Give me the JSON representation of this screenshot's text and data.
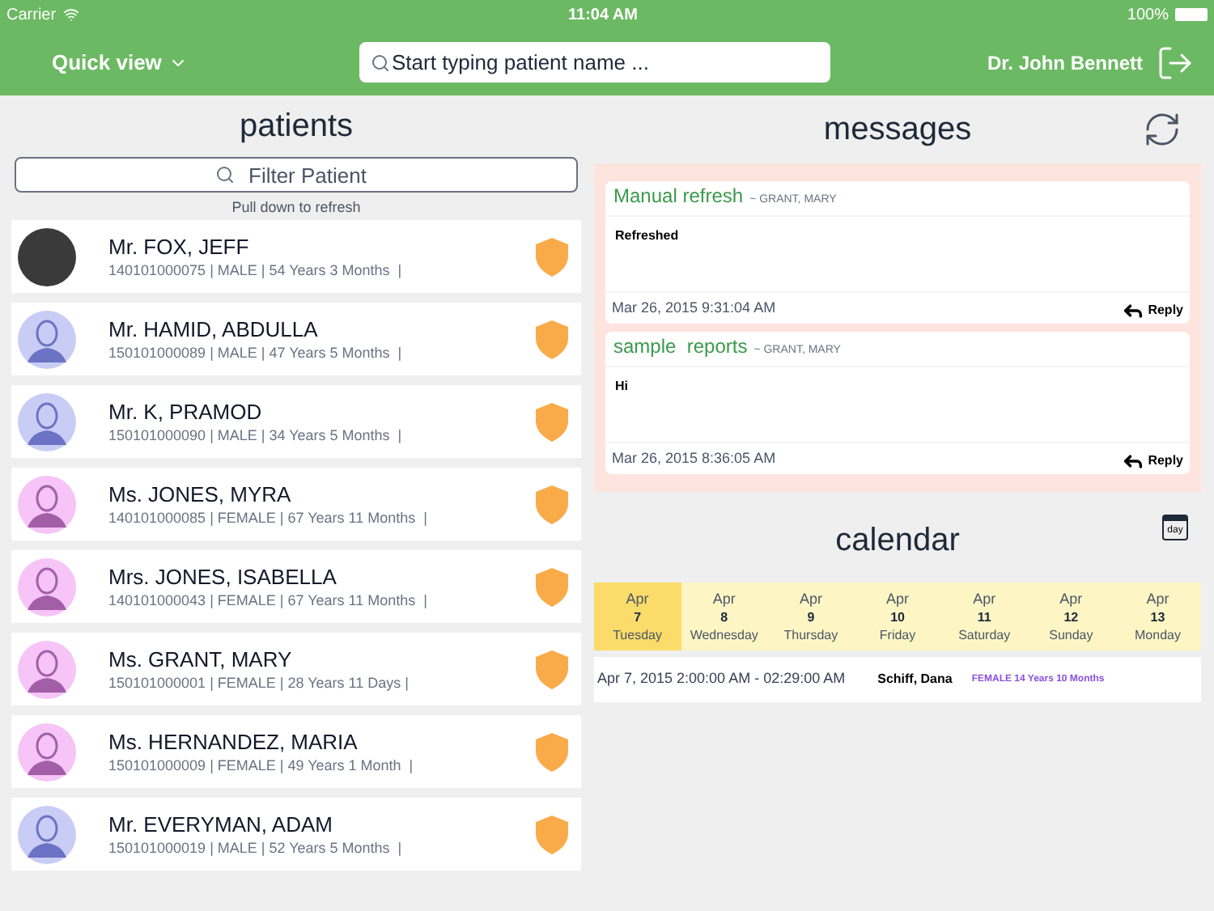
{
  "status_bar": {
    "carrier": "Carrier",
    "time": "11:04 AM",
    "battery": "100%"
  },
  "nav": {
    "quick_view": "Quick view",
    "search_placeholder": "Start typing patient name ...",
    "user": "Dr. John Bennett"
  },
  "patients": {
    "title": "patients",
    "filter_placeholder": "Filter Patient",
    "hint": "Pull down to refresh",
    "items": [
      {
        "name": "Mr. FOX, JEFF",
        "meta": "140101000075 | MALE | 54 Years 3 Months  |",
        "kind": "photo"
      },
      {
        "name": "Mr. HAMID, ABDULLA",
        "meta": "150101000089 | MALE | 47 Years 5 Months  |",
        "kind": "male"
      },
      {
        "name": "Mr. K, PRAMOD",
        "meta": "150101000090 | MALE | 34 Years 5 Months  |",
        "kind": "male"
      },
      {
        "name": "Ms. JONES, MYRA",
        "meta": "140101000085 | FEMALE | 67 Years 11 Months  |",
        "kind": "female"
      },
      {
        "name": "Mrs. JONES, ISABELLA",
        "meta": "140101000043 | FEMALE | 67 Years 11 Months  |",
        "kind": "female"
      },
      {
        "name": "Ms. GRANT, MARY",
        "meta": "150101000001 | FEMALE | 28 Years 11 Days |",
        "kind": "female"
      },
      {
        "name": "Ms. HERNANDEZ, MARIA",
        "meta": "150101000009 | FEMALE | 49 Years 1 Month  |",
        "kind": "female"
      },
      {
        "name": "Mr. EVERYMAN, ADAM",
        "meta": "150101000019 | MALE | 52 Years 5 Months  |",
        "kind": "male"
      }
    ]
  },
  "messages": {
    "title": "messages",
    "items": [
      {
        "subject": "Manual refresh",
        "from": "~ GRANT, MARY",
        "body": "Refreshed",
        "date": "Mar 26, 2015 9:31:04 AM",
        "reply": "Reply"
      },
      {
        "subject": "sample  reports",
        "from": "~ GRANT, MARY",
        "body": "Hi",
        "date": "Mar 26, 2015 8:36:05 AM",
        "reply": "Reply"
      }
    ]
  },
  "calendar": {
    "title": "calendar",
    "icon_label": "day",
    "days": [
      {
        "month": "Apr",
        "day": "7",
        "weekday": "Tuesday",
        "selected": true
      },
      {
        "month": "Apr",
        "day": "8",
        "weekday": "Wednesday",
        "selected": false
      },
      {
        "month": "Apr",
        "day": "9",
        "weekday": "Thursday",
        "selected": false
      },
      {
        "month": "Apr",
        "day": "10",
        "weekday": "Friday",
        "selected": false
      },
      {
        "month": "Apr",
        "day": "11",
        "weekday": "Saturday",
        "selected": false
      },
      {
        "month": "Apr",
        "day": "12",
        "weekday": "Sunday",
        "selected": false
      },
      {
        "month": "Apr",
        "day": "13",
        "weekday": "Monday",
        "selected": false
      }
    ],
    "appointments": [
      {
        "time": "Apr 7, 2015 2:00:00 AM - 02:29:00 AM",
        "patient": "Schiff, Dana",
        "info": "FEMALE 14 Years 10 Months"
      }
    ]
  }
}
